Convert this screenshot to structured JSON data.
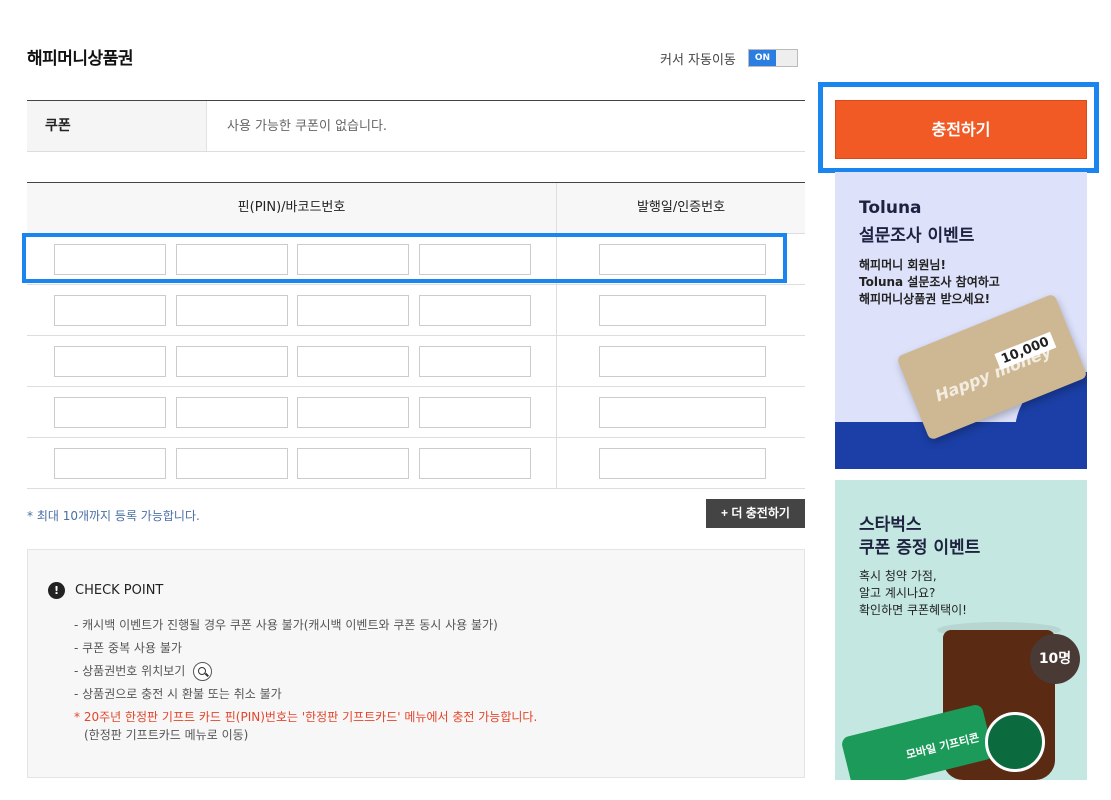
{
  "page": {
    "title": "해피머니상품권",
    "cursor_auto_label": "커서 자동이동",
    "toggle_state": "ON"
  },
  "coupon": {
    "label": "쿠폰",
    "value": "사용 가능한 쿠폰이 없습니다."
  },
  "pin_table": {
    "header_pin": "핀(PIN)/바코드번호",
    "header_date": "발행일/인증번호",
    "rows": 5,
    "pin_fields_per_row": 4
  },
  "max_note": "* 최대 10개까지 등록 가능합니다.",
  "more_button": "+ 더 충전하기",
  "checkpoint": {
    "icon": "!",
    "title": "CHECK POINT",
    "items": [
      "- 캐시백 이벤트가 진행될 경우 쿠폰 사용 불가(캐시백 이벤트와 쿠폰 동시 사용 불가)",
      "- 쿠폰 중복 사용 불가",
      "- 상품권번호 위치보기",
      "- 상품권으로 충전 시 환불 또는 취소 불가"
    ],
    "notice": "* 20주년 한정판 기프트 카드 핀(PIN)번호는 '한정판 기프트카드' 메뉴에서 충전 가능합니다.",
    "notice_sub": "(한정판 기프트카드 메뉴로 이동)"
  },
  "charge_button": "충전하기",
  "banner_toluna": {
    "title_line1": "Toluna",
    "title_line2": "설문조사 이벤트",
    "text_line1": "해피머니 회원님!",
    "text_line2": "Toluna 설문조사 참여하고",
    "text_line3": "해피머니상품권 받으세요!",
    "ticket_value": "10,000",
    "ticket_brand": "Happy money"
  },
  "banner_starbucks": {
    "title_line1": "스타벅스",
    "title_line2": "쿠폰 증정 이벤트",
    "text_line1": "혹시 청약 가점,",
    "text_line2": "알고 계시나요?",
    "text_line3": "확인하면 쿠폰혜택이!",
    "badge": "10명",
    "gift_card_text": "모바일 기프티콘"
  },
  "colors": {
    "accent_orange": "#f15a24",
    "highlight_blue": "#1a84ef",
    "toggle_blue": "#2a7de1"
  }
}
